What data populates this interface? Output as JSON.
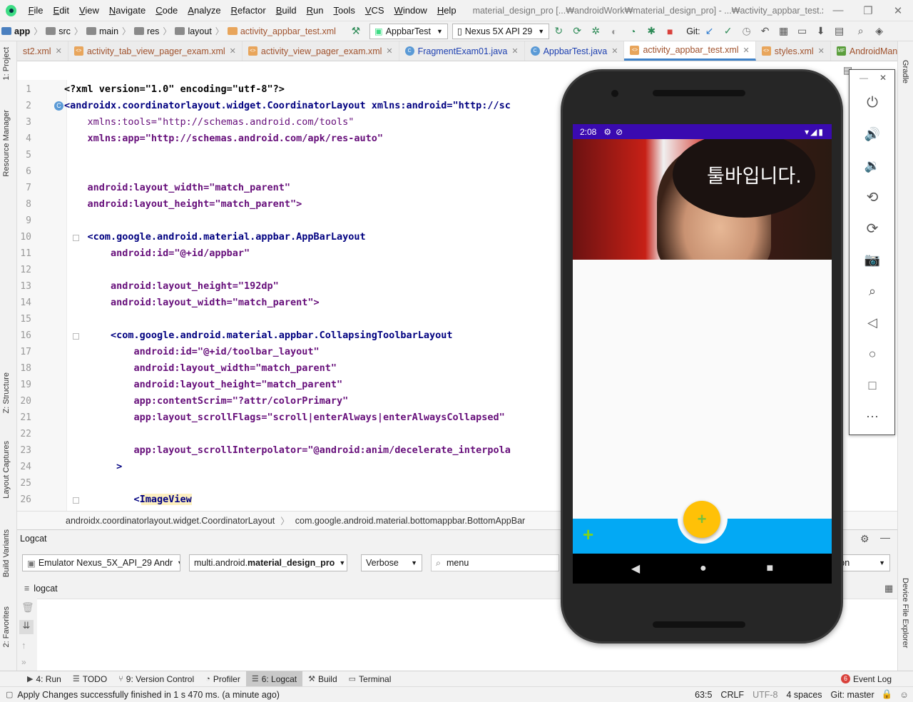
{
  "menubar": {
    "items": [
      "File",
      "Edit",
      "View",
      "Navigate",
      "Code",
      "Analyze",
      "Refactor",
      "Build",
      "Run",
      "Tools",
      "VCS",
      "Window",
      "Help"
    ],
    "window_title": "material_design_pro [...₩androidWork₩material_design_pro] - ...₩activity_appbar_test.xml [app]"
  },
  "navbar": {
    "crumbs": [
      "app",
      "src",
      "main",
      "res",
      "layout",
      "activity_appbar_test.xml"
    ],
    "run_config": "AppbarTest",
    "device": "Nexus 5X API 29",
    "git_label": "Git:"
  },
  "tabs": [
    {
      "label": "st2.xml",
      "type": "xml"
    },
    {
      "label": "activity_tab_view_pager_exam.xml",
      "type": "xml"
    },
    {
      "label": "activity_view_pager_exam.xml",
      "type": "xml"
    },
    {
      "label": "FragmentExam01.java",
      "type": "java"
    },
    {
      "label": "AppbarTest.java",
      "type": "java"
    },
    {
      "label": "activity_appbar_test.xml",
      "type": "xml",
      "active": true
    },
    {
      "label": "styles.xml",
      "type": "xml"
    },
    {
      "label": "AndroidManifest",
      "type": "xml"
    }
  ],
  "left_tools": [
    "1: Project",
    "Resource Manager",
    "Z: Structure",
    "Layout Captures",
    "Build Variants",
    "2: Favorites"
  ],
  "right_tools": [
    "Gradle",
    "Device File Explorer"
  ],
  "editor": {
    "line_numbers": [
      "1",
      "2",
      "3",
      "4",
      "5",
      "6",
      "7",
      "8",
      "9",
      "10",
      "11",
      "12",
      "13",
      "14",
      "15",
      "16",
      "17",
      "18",
      "19",
      "20",
      "21",
      "22",
      "23",
      "24",
      "25",
      "26"
    ],
    "lines": {
      "l1": "<?xml version=\"1.0\" encoding=\"utf-8\"?>",
      "l2": "<androidx.coordinatorlayout.widget.CoordinatorLayout xmlns:android=\"http://sc",
      "l3": "    xmlns:tools=\"http://schemas.android.com/tools\"",
      "l4": "    xmlns:app=\"http://schemas.android.com/apk/res-auto\"",
      "l7": "    android:layout_width=\"match_parent\"",
      "l8": "    android:layout_height=\"match_parent\">",
      "l10": "    <com.google.android.material.appbar.AppBarLayout",
      "l11": "        android:id=\"@+id/appbar\"",
      "l13": "        android:layout_height=\"192dp\"",
      "l14": "        android:layout_width=\"match_parent\">",
      "l16": "        <com.google.android.material.appbar.CollapsingToolbarLayout",
      "l17": "            android:id=\"@+id/toolbar_layout\"",
      "l18": "            android:layout_width=\"match_parent\"",
      "l19": "            android:layout_height=\"match_parent\"",
      "l20": "            app:contentScrim=\"?attr/colorPrimary\"",
      "l21": "            app:layout_scrollFlags=\"scroll|enterAlways|enterAlwaysCollapsed\"",
      "l23": "            app:layout_scrollInterpolator=\"@android:anim/decelerate_interpola",
      "l24": "         >",
      "l26": "            <ImageView"
    }
  },
  "xml_breadcrumb": [
    "androidx.coordinatorlayout.widget.CoordinatorLayout",
    "com.google.android.material.bottomappbar.BottomAppBar"
  ],
  "logcat": {
    "title": "Logcat",
    "device": "Emulator Nexus_5X_API_29 Andr",
    "process_prefix": "multi.android.",
    "process_bold": "material_design_pro",
    "level": "Verbose",
    "search": "menu",
    "right_filter": "tion",
    "tab": "logcat"
  },
  "bottom_tools": [
    {
      "label": "4: Run",
      "icon": "run-icon"
    },
    {
      "label": "TODO",
      "icon": "todo-icon"
    },
    {
      "label": "9: Version Control",
      "icon": "vcs-icon"
    },
    {
      "label": "Profiler",
      "icon": "profiler-icon"
    },
    {
      "label": "6: Logcat",
      "icon": "logcat-icon",
      "active": true
    },
    {
      "label": "Build",
      "icon": "build-icon"
    },
    {
      "label": "Terminal",
      "icon": "terminal-icon"
    }
  ],
  "event_log": {
    "label": "Event Log",
    "count": "6"
  },
  "statusbar": {
    "message": "Apply Changes successfully finished in 1 s 470 ms. (a minute ago)",
    "position": "63:5",
    "line_sep": "CRLF",
    "encoding": "UTF-8",
    "indent": "4 spaces",
    "git": "Git: master"
  },
  "phone": {
    "time": "2:08",
    "toolbar_title": "툴바입니다.",
    "fab_symbol": "+",
    "nav_symbol": "+"
  },
  "colors": {
    "accent": "#4083c9",
    "status_purple": "#3a0ab0",
    "bottom_appbar": "#03a9f4",
    "fab": "#ffc107"
  }
}
